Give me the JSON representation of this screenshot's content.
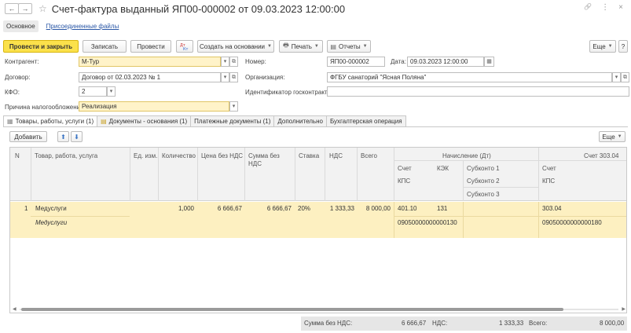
{
  "window": {
    "title": "Счет-фактура выданный ЯП00-000002 от 09.03.2023 12:00:00",
    "back_icon": "←",
    "forward_icon": "→",
    "star_icon": "☆",
    "link_icon": "🔗",
    "more_icon": "⋮",
    "close_icon": "×"
  },
  "form_tabs": {
    "main": "Основное",
    "files": "Присоединенные файлы"
  },
  "toolbar": {
    "post_close": "Провести и закрыть",
    "save": "Записать",
    "post": "Провести",
    "create_based": "Создать на основании",
    "print": "Печать",
    "reports": "Отчеты",
    "more": "Еще",
    "help": "?"
  },
  "fields": {
    "kontragent_label": "Контрагент:",
    "kontragent": "М-Тур",
    "dogovor_label": "Договор:",
    "dogovor": "Договор от 02.03.2023 № 1",
    "kfo_label": "КФО:",
    "kfo": "2",
    "prichina_label": "Причина налогообложения:",
    "prichina": "Реализация",
    "nomer_label": "Номер:",
    "nomer": "ЯП00-000002",
    "data_label": "Дата:",
    "data": "09.03.2023 12:00:00",
    "org_label": "Организация:",
    "org": "ФГБУ санаторий \"Ясная Поляна\"",
    "goskontrakt_label": "Идентификатор госконтракта:",
    "goskontrakt": ""
  },
  "table_tabs": [
    "Товары, работы, услуги (1)",
    "Документы - основания (1)",
    "Платежные документы (1)",
    "Дополнительно",
    "Бухгалтерская операция"
  ],
  "table_toolbar": {
    "add": "Добавить",
    "up": "⬆",
    "down": "⬇",
    "more": "Еще"
  },
  "columns": {
    "n": "N",
    "item": "Товар, работа, услуга",
    "unit": "Ед. изм.",
    "qty": "Количество",
    "price": "Цена без НДС",
    "sum": "Сумма без НДС",
    "rate": "Ставка",
    "vat": "НДС",
    "total": "Всего",
    "accrual_group": "Начисление (Дт)",
    "schet": "Счет",
    "kek": "КЭК",
    "subkonto1": "Субконто 1",
    "kps": "КПС",
    "subkonto2": "Субконто 2",
    "subkonto3": "Субконто 3",
    "credit_group": "Счет 303.04",
    "credit_schet": "Счет",
    "credit_kps": "КПС"
  },
  "rows": [
    {
      "n": "1",
      "item": "Медуслуги",
      "item_sub": "Медуслуги",
      "unit": "",
      "qty": "1,000",
      "price": "6 666,67",
      "sum": "6 666,67",
      "rate": "20%",
      "vat": "1 333,33",
      "total": "8 000,00",
      "schet": "401.10",
      "kek": "131",
      "kps": "09050000000000130",
      "credit_schet": "303.04",
      "credit_kps": "09050000000000180"
    }
  ],
  "totals": {
    "sum_label": "Сумма без НДС:",
    "sum": "6 666,67",
    "vat_label": "НДС:",
    "vat": "1 333,33",
    "total_label": "Всего:",
    "total": "8 000,00"
  }
}
